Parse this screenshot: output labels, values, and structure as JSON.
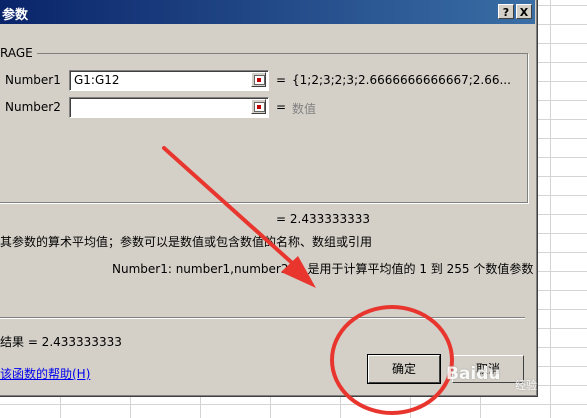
{
  "window": {
    "title": "参数",
    "help_button": "?",
    "close_button": "X"
  },
  "function_name": "RAGE",
  "args": [
    {
      "label": "Number1",
      "value": "G1:G12",
      "result": "{1;2;3;2;3;2.6666666666667;2.66..."
    },
    {
      "label": "Number2",
      "value": "",
      "result": "数值"
    }
  ],
  "formula_result_line": "= 2.433333333",
  "description": "其参数的算术平均值；参数可以是数值或包含数值的名称、数组或引用",
  "arg_help": "Number1: number1,number2,... 是用于计算平均值的 1 到 255 个数值参数",
  "result_label": "结果 = 2.433333333",
  "help_link": "该函数的帮助(H)",
  "buttons": {
    "ok": "确定",
    "cancel": "取消"
  },
  "watermark": {
    "text": "Baidu",
    "sub": "经验"
  },
  "annotation_color": "#e8362f"
}
